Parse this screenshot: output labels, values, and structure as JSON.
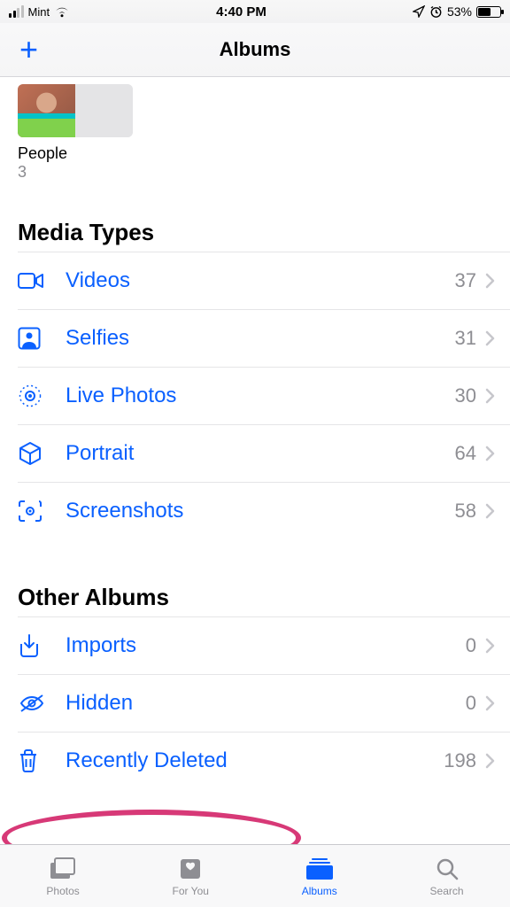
{
  "status": {
    "carrier": "Mint",
    "time": "4:40 PM",
    "battery_pct": "53%"
  },
  "nav": {
    "title": "Albums",
    "add_label": "+"
  },
  "people_album": {
    "title": "People",
    "count": "3"
  },
  "sections": [
    {
      "title": "Media Types",
      "items": [
        {
          "icon": "video-icon",
          "label": "Videos",
          "count": "37"
        },
        {
          "icon": "selfie-icon",
          "label": "Selfies",
          "count": "31"
        },
        {
          "icon": "live-photo-icon",
          "label": "Live Photos",
          "count": "30"
        },
        {
          "icon": "cube-icon",
          "label": "Portrait",
          "count": "64"
        },
        {
          "icon": "screenshot-icon",
          "label": "Screenshots",
          "count": "58"
        }
      ]
    },
    {
      "title": "Other Albums",
      "items": [
        {
          "icon": "import-icon",
          "label": "Imports",
          "count": "0"
        },
        {
          "icon": "hidden-icon",
          "label": "Hidden",
          "count": "0"
        },
        {
          "icon": "trash-icon",
          "label": "Recently Deleted",
          "count": "198"
        }
      ]
    }
  ],
  "tabs": [
    {
      "label": "Photos",
      "active": false
    },
    {
      "label": "For You",
      "active": false
    },
    {
      "label": "Albums",
      "active": true
    },
    {
      "label": "Search",
      "active": false
    }
  ]
}
